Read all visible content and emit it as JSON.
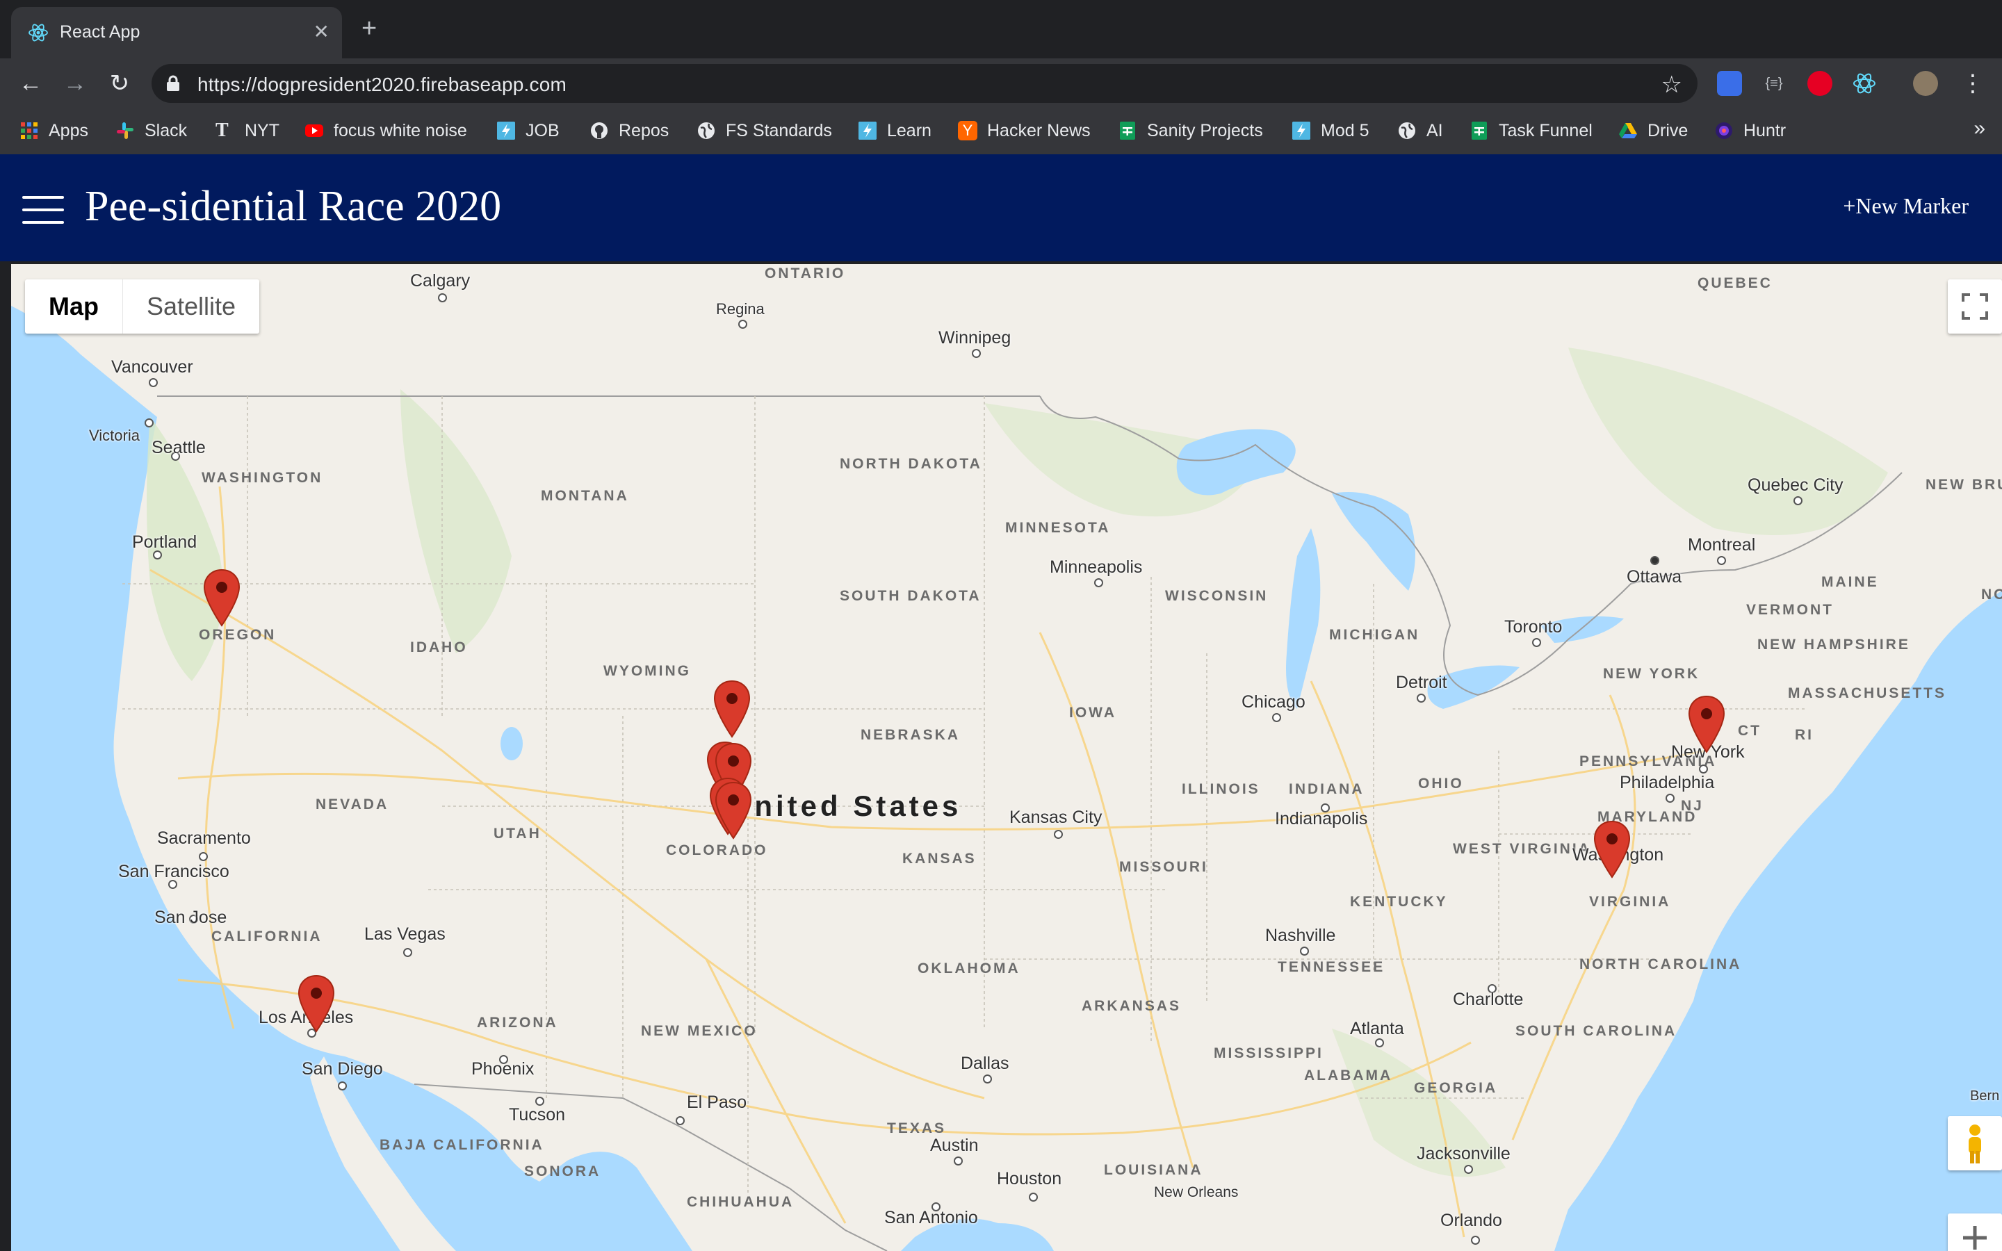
{
  "browser": {
    "tab_title": "React App",
    "tab_close": "✕",
    "new_tab": "+",
    "url": "https://dogpresident2020.firebaseapp.com",
    "back": "←",
    "forward": "→",
    "reload": "↻",
    "star": "☆",
    "menu": "⋮",
    "bookmarks_more": "»",
    "bookmarks": [
      {
        "label": "Apps",
        "icon": "apps-grid-icon",
        "color": "#ea4335"
      },
      {
        "label": "Slack",
        "icon": "slack-icon",
        "color": "#e01e5a"
      },
      {
        "label": "NYT",
        "icon": "nyt-icon",
        "color": "#e8eaed"
      },
      {
        "label": "focus white noise",
        "icon": "youtube-icon",
        "color": "#ff0000"
      },
      {
        "label": "JOB",
        "icon": "learn-bolt-icon",
        "color": "#4fb7e3"
      },
      {
        "label": "Repos",
        "icon": "github-icon",
        "color": "#e8eaed"
      },
      {
        "label": "FS Standards",
        "icon": "globe-icon",
        "color": "#e8eaed"
      },
      {
        "label": "Learn",
        "icon": "learn-bolt-icon",
        "color": "#4fb7e3"
      },
      {
        "label": "Hacker News",
        "icon": "hacker-news-icon",
        "color": "#ff6600"
      },
      {
        "label": "Sanity Projects",
        "icon": "sheets-icon",
        "color": "#0f9d58"
      },
      {
        "label": "Mod 5",
        "icon": "learn-bolt-icon",
        "color": "#4fb7e3"
      },
      {
        "label": "AI",
        "icon": "globe-icon",
        "color": "#e8eaed"
      },
      {
        "label": "Task Funnel",
        "icon": "sheets-icon",
        "color": "#0f9d58"
      },
      {
        "label": "Drive",
        "icon": "drive-icon",
        "color": "#fbbc04"
      },
      {
        "label": "Huntr",
        "icon": "huntr-icon",
        "color": "#7b3fe4"
      }
    ]
  },
  "app": {
    "title": "Pee-sidential Race 2020",
    "new_marker": "+New Marker",
    "header_color": "#011a5e"
  },
  "map": {
    "map_type": {
      "map": "Map",
      "satellite": "Satellite"
    },
    "country": "United States",
    "cities": [
      "Calgary",
      "Regina",
      "Winnipeg",
      "Vancouver",
      "Victoria",
      "Seattle",
      "Portland",
      "Quebec City",
      "Montreal",
      "Ottawa",
      "Toronto",
      "Minneapolis",
      "Chicago",
      "Detroit",
      "New York",
      "Philadelphia",
      "Washington",
      "Kansas City",
      "Indianapolis",
      "Nashville",
      "Charlotte",
      "Atlanta",
      "Jacksonville",
      "Orlando",
      "Dallas",
      "Austin",
      "Houston",
      "San Antonio",
      "El Paso",
      "Phoenix",
      "Tucson",
      "Las Vegas",
      "Los Angeles",
      "San Diego",
      "Sacramento",
      "San Francisco",
      "San Jose",
      "New Orleans",
      "Bern"
    ],
    "states": [
      "ONTARIO",
      "QUEBEC",
      "WASHINGTON",
      "MONTANA",
      "NORTH DAKOTA",
      "MINNESOTA",
      "OREGON",
      "IDAHO",
      "SOUTH DAKOTA",
      "WISCONSIN",
      "MICHIGAN",
      "WYOMING",
      "NEBRASKA",
      "IOWA",
      "NEVADA",
      "UTAH",
      "COLORADO",
      "KANSAS",
      "MISSOURI",
      "ILLINOIS",
      "INDIANA",
      "OHIO",
      "PENNSYLVANIA",
      "NEW YORK",
      "VERMONT",
      "MAINE",
      "NEW HAMPSHIRE",
      "MASSACHUSETTS",
      "CT",
      "RI",
      "NJ",
      "MARYLAND",
      "WEST VIRGINIA",
      "VIRGINIA",
      "KENTUCKY",
      "TENNESSEE",
      "NORTH CAROLINA",
      "SOUTH CAROLINA",
      "CALIFORNIA",
      "ARIZONA",
      "NEW MEXICO",
      "OKLAHOMA",
      "ARKANSAS",
      "TEXAS",
      "LOUISIANA",
      "MISSISSIPPI",
      "ALABAMA",
      "GEORGIA",
      "BAJA CALIFORNIA",
      "SONORA",
      "CHIHUAHUA",
      "NEW BRUNSWICK",
      "NO"
    ],
    "marker_color": "#d93a2b",
    "markers": [
      "Oregon",
      "Wyoming",
      "Colorado",
      "Colorado",
      "Colorado",
      "New York",
      "Washington",
      "Los Angeles"
    ]
  }
}
